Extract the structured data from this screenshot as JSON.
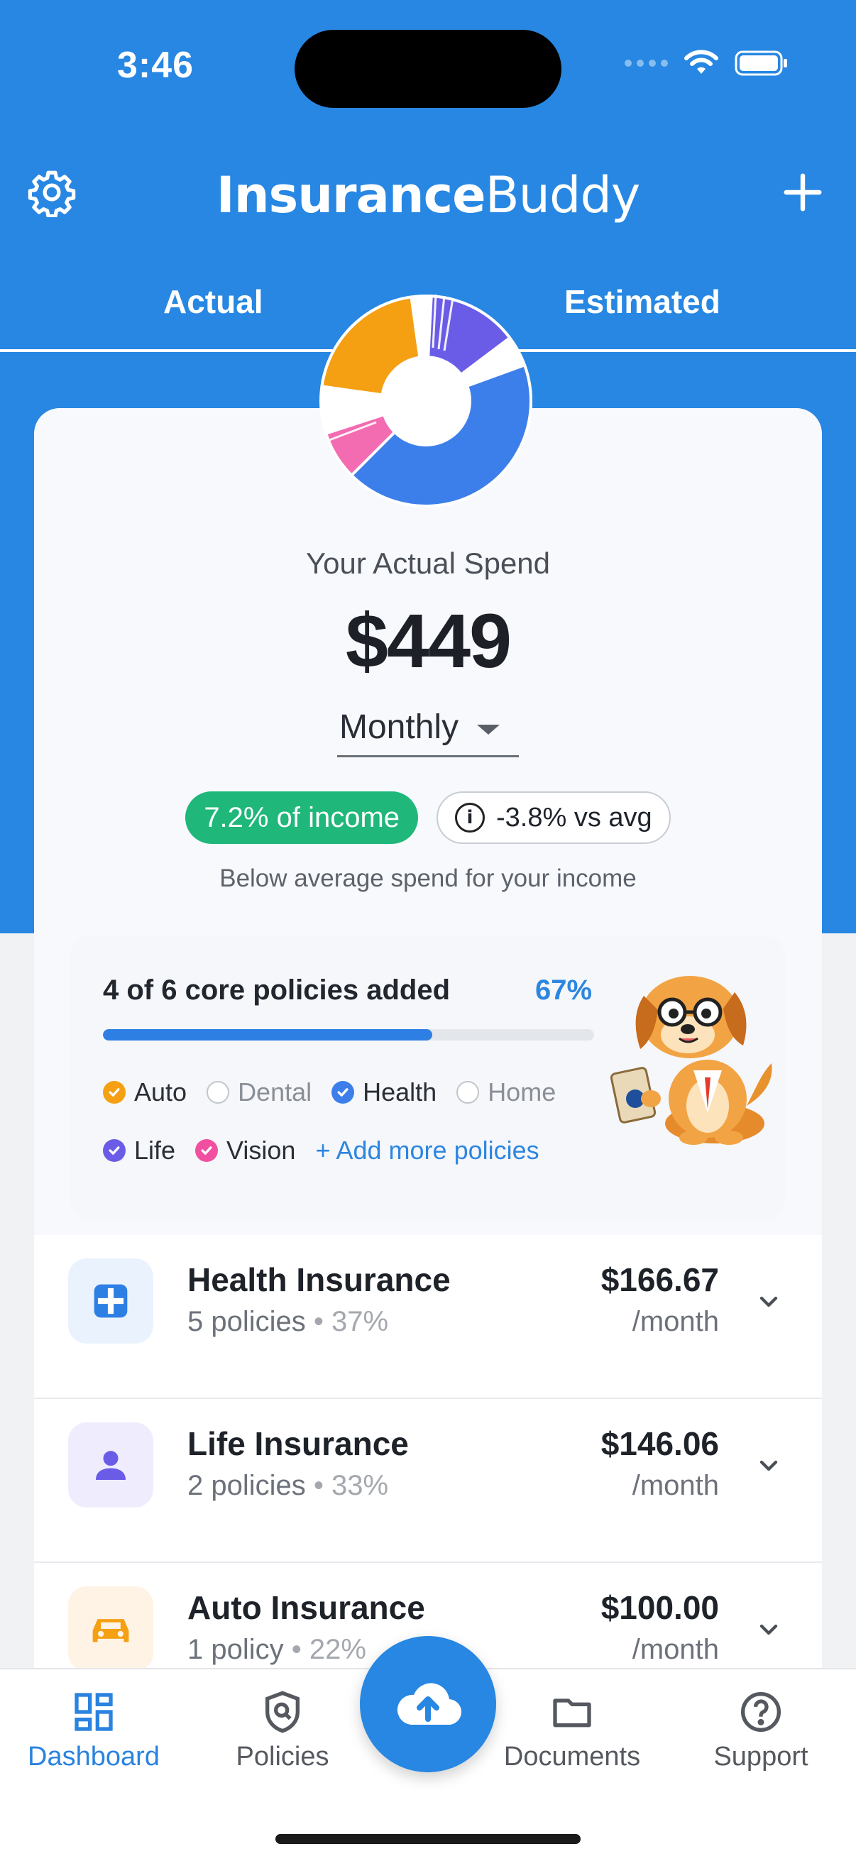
{
  "status": {
    "time": "3:46"
  },
  "header": {
    "brand_bold": "Insurance",
    "brand_light": "Buddy"
  },
  "tabs": [
    {
      "label": "Actual"
    },
    {
      "label": "Estimated"
    }
  ],
  "summary": {
    "label": "Your Actual Spend",
    "amount": "$449",
    "period": "Monthly",
    "income_badge": "7.2% of income",
    "avg_badge": "-3.8% vs avg",
    "note": "Below average spend for your income"
  },
  "donut": {
    "segments": [
      {
        "name": "Auto",
        "color": "#F4A012"
      },
      {
        "name": "Life",
        "color": "#6B5CE7"
      },
      {
        "name": "Health",
        "color": "#3D7FEA"
      },
      {
        "name": "Vision",
        "color": "#F36BB1"
      }
    ]
  },
  "progress": {
    "title": "4 of 6 core policies added",
    "percent_label": "67%",
    "fraction": 0.67,
    "add_more": "+ Add more policies",
    "policies": [
      {
        "label": "Auto",
        "added": true,
        "color": "#F4A012"
      },
      {
        "label": "Dental",
        "added": false
      },
      {
        "label": "Health",
        "added": true,
        "color": "#3D7FEA"
      },
      {
        "label": "Home",
        "added": false
      },
      {
        "label": "Life",
        "added": true,
        "color": "#6B5CE7"
      },
      {
        "label": "Vision",
        "added": true,
        "color": "#F0509F"
      }
    ]
  },
  "categories": [
    {
      "name": "Health Insurance",
      "count": "5 policies",
      "share": "37%",
      "amount": "$166.67",
      "period": "/month",
      "icon": "medical-cross-icon",
      "bg": "#EAF2FE",
      "fg": "#2E7FE3"
    },
    {
      "name": "Life Insurance",
      "count": "2 policies",
      "share": "33%",
      "amount": "$146.06",
      "period": "/month",
      "icon": "person-icon",
      "bg": "#EFEDFD",
      "fg": "#6B5CE7"
    },
    {
      "name": "Auto Insurance",
      "count": "1 policy",
      "share": "22%",
      "amount": "$100.00",
      "period": "/month",
      "icon": "car-icon",
      "bg": "#FFF3E5",
      "fg": "#F4A012"
    }
  ],
  "tabbar": [
    {
      "label": "Dashboard",
      "icon": "dashboard-icon",
      "active": true
    },
    {
      "label": "Policies",
      "icon": "shield-icon",
      "active": false
    },
    {
      "label": "Documents",
      "icon": "folder-icon",
      "active": false
    },
    {
      "label": "Support",
      "icon": "help-icon",
      "active": false
    }
  ],
  "fab": {
    "icon": "cloud-upload-icon"
  },
  "colors": {
    "brand": "#2787E2",
    "success": "#1FB77A"
  }
}
